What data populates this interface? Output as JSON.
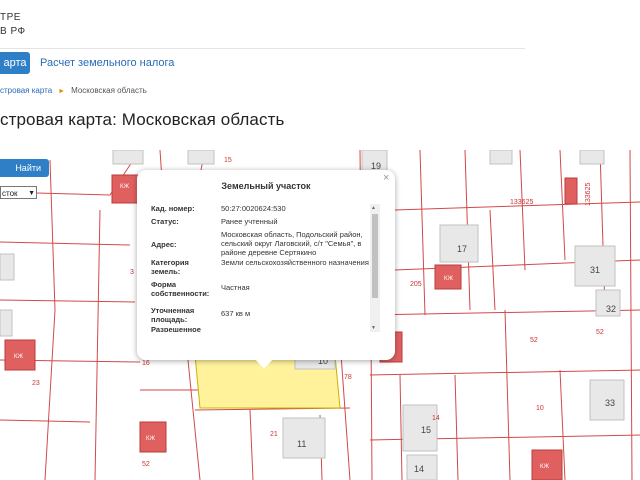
{
  "brand": {
    "line1": "ТРЕ",
    "line2": "В РФ"
  },
  "nav": {
    "tabs": [
      {
        "label": "арта"
      },
      {
        "label": "Расчет земельного налога"
      }
    ]
  },
  "breadcrumb": {
    "link": "стровая карта",
    "current": "Московская область"
  },
  "page_title": "стровая карта: Московская область",
  "search": {
    "button": "Найти",
    "select_value": "сток"
  },
  "popup": {
    "title": "Земельный участок",
    "close": "×",
    "rows": [
      {
        "key": "Кад. номер:",
        "value": "50:27:0020624:530"
      },
      {
        "key": "Статус:",
        "value": "Ранее учтенный"
      },
      {
        "key": "Адрес:",
        "value": "Московская область, Подольский район, сельский округ Лаговский, с/т \"Семья\", в районе деревне Сертякино"
      },
      {
        "key": "Категория земель:",
        "value": "Земли сельскохозяйственного назначения"
      },
      {
        "key": "Форма собственности:",
        "value": "Частная"
      },
      {
        "key": "Уточненная площадь:",
        "value": "637 кв м"
      },
      {
        "key": "Разрешенное",
        "value": ""
      }
    ]
  },
  "map": {
    "parcel_labels": [
      "15",
      "19",
      "133625",
      "133625",
      "17",
      "31",
      "3",
      "205",
      "32",
      "52",
      "52",
      "16",
      "10",
      "78",
      "23",
      "21",
      "11",
      "14",
      "15",
      "14",
      "10",
      "33",
      "52"
    ],
    "building_labels": [
      "КЖ",
      "КЖ",
      "КЖ",
      "КЖ",
      "КЖ"
    ]
  },
  "colors": {
    "accent": "#2f7fc6",
    "parcel_line": "#d24a4a",
    "building": "#e06060",
    "selected_parcel": "#fff29a"
  }
}
